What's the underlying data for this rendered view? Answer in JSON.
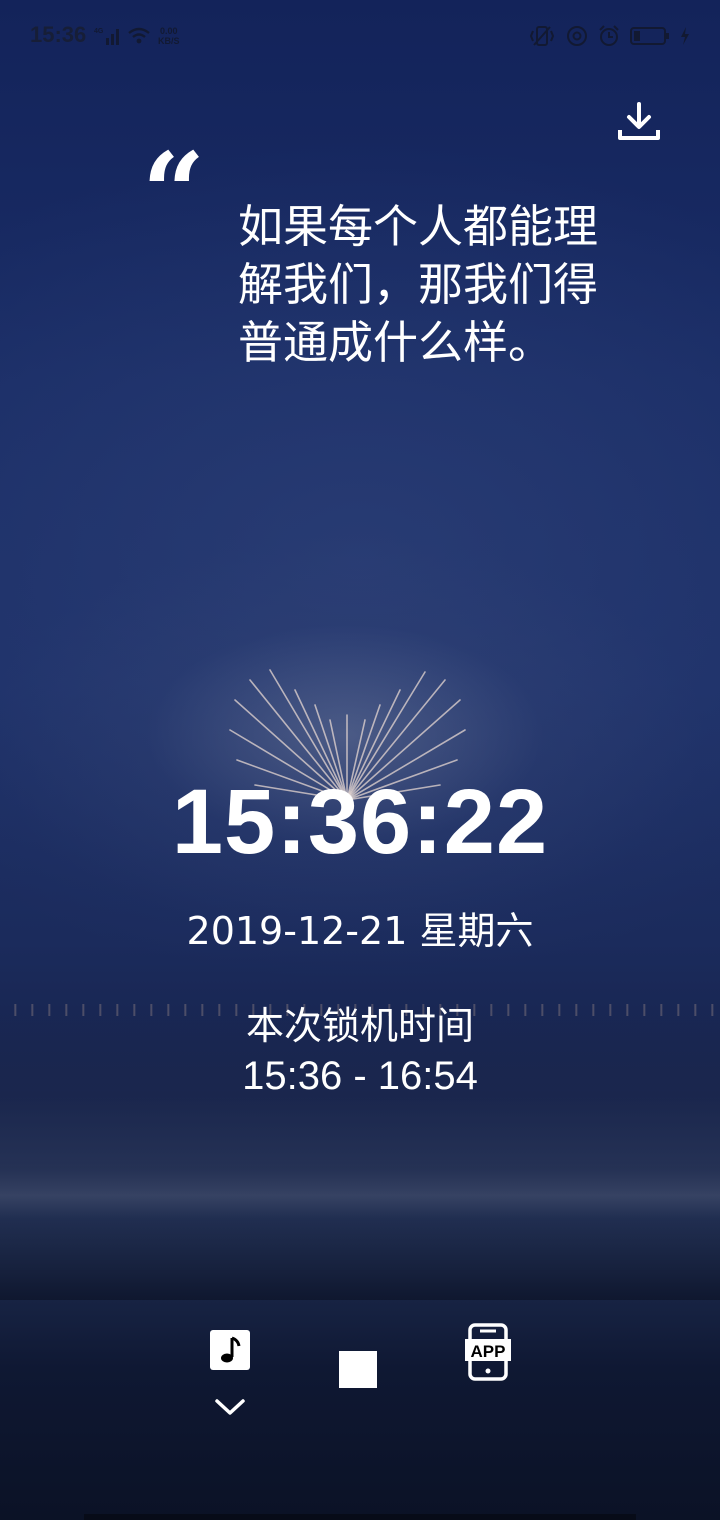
{
  "status_bar": {
    "time": "15:36",
    "net_speed_value": "0.00",
    "net_speed_unit": "KB/S",
    "signal_label": "4G",
    "icons": [
      "signal-icon",
      "wifi-icon",
      "vibrate-icon",
      "at-icon",
      "alarm-icon",
      "battery-icon",
      "charging-icon"
    ]
  },
  "quote": {
    "mark": "“",
    "text": "如果每个人都能理解我们，那我们得普通成什么样。"
  },
  "clock": {
    "time": "15:36:22",
    "date": "2019-12-21 星期六"
  },
  "lock_session": {
    "label": "本次锁机时间",
    "range": "15:36 - 16:54"
  },
  "controls": {
    "app_label": "APP",
    "icons": [
      "download-icon",
      "music-note-icon",
      "chevron-down-icon",
      "stop-icon",
      "app-phone-icon"
    ]
  },
  "colors": {
    "sky_top": "#13235a",
    "sky_mid": "#1d3068",
    "sea_dark": "#0b1226",
    "text": "#ffffff"
  }
}
